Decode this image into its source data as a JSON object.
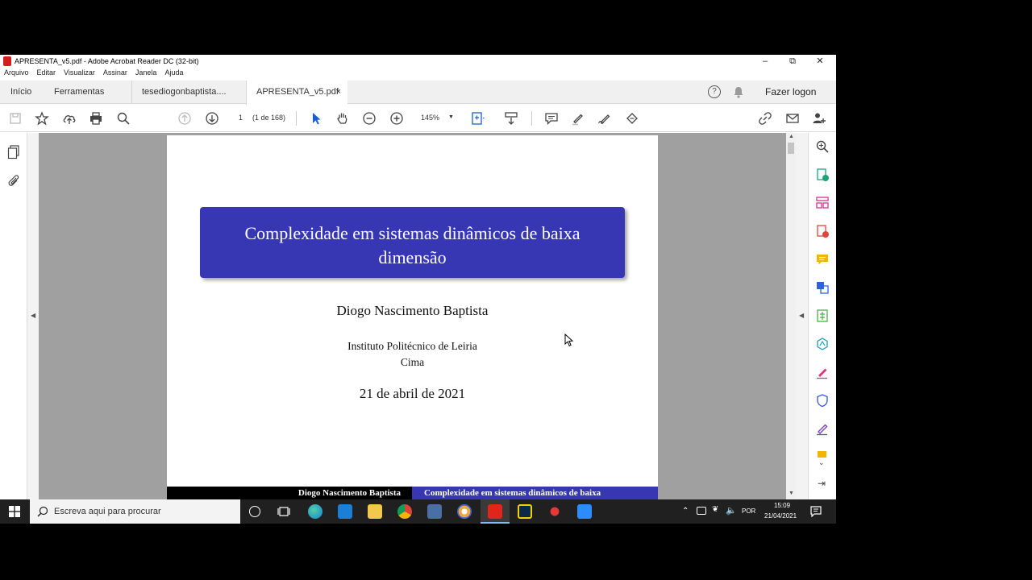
{
  "window": {
    "title": "APRESENTA_v5.pdf - Adobe Acrobat Reader DC (32-bit)"
  },
  "menu": [
    "Arquivo",
    "Editar",
    "Visualizar",
    "Assinar",
    "Janela",
    "Ajuda"
  ],
  "tabs": {
    "home": "Início",
    "tools": "Ferramentas",
    "doc1": "tesediogonbaptista....",
    "doc2": "APRESENTA_v5.pdf",
    "close": "×",
    "login": "Fazer logon",
    "help": "?"
  },
  "toolbar": {
    "page_number": "1",
    "page_count": "(1 de 168)",
    "zoom": "145%"
  },
  "slide": {
    "title_line1": "Complexidade em sistemas dinâmicos de baixa",
    "title_line2": "dimensão",
    "author": "Diogo Nascimento Baptista",
    "institute": "Instituto Politécnico de Leiria",
    "place": "Cima",
    "date": "21 de abril de 2021",
    "footer_left": "Diogo Nascimento Baptista",
    "footer_right": "Complexidade em sistemas dinâmicos de baixa",
    "title_bg": "#3737b4"
  },
  "taskbar": {
    "search_placeholder": "Escreva aqui para procurar",
    "language": "POR",
    "time": "15:09",
    "date": "21/04/2021"
  }
}
